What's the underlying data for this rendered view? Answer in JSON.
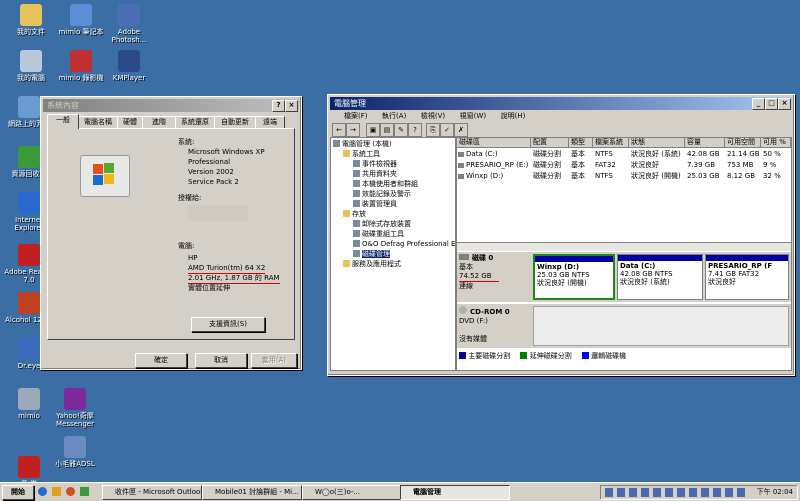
{
  "desktop_icons": [
    {
      "label": "我的文件",
      "icon": "folder-icon",
      "color": "#e8c25a"
    },
    {
      "label": "mimio 筆記本",
      "icon": "notebook-icon",
      "color": "#5b8ed6"
    },
    {
      "label": "Adobe Photosh...",
      "icon": "photoshop-icon",
      "color": "#4a6fb5"
    },
    {
      "label": "我的電腦",
      "icon": "computer-icon",
      "color": "#b8c8d8"
    },
    {
      "label": "mimio 錄影機",
      "icon": "recorder-icon",
      "color": "#c03030"
    },
    {
      "label": "KMPlayer",
      "icon": "kmplayer-icon",
      "color": "#2a4a8a"
    },
    {
      "label": "網路上的芳鄰",
      "icon": "network-icon",
      "color": "#6a9ad0"
    },
    {
      "label": "資源回收筒",
      "icon": "recycle-bin-icon",
      "color": "#3a9a3a"
    },
    {
      "label": "Internet Explorer",
      "icon": "ie-icon",
      "color": "#2a6ad0"
    },
    {
      "label": "Adobe Reader 7.0",
      "icon": "acrobat-icon",
      "color": "#c02020"
    },
    {
      "label": "Alcohol 120%",
      "icon": "alcohol-icon",
      "color": "#c04020"
    },
    {
      "label": "Dr.eye",
      "icon": "dreye-icon",
      "color": "#3a6aba"
    },
    {
      "label": "mimio",
      "icon": "mimio-icon",
      "color": "#9aaabb"
    },
    {
      "label": "Yahoo!奇摩 Messenger",
      "icon": "yahoo-messenger-icon",
      "color": "#7a2a9a"
    },
    {
      "label": "小毛雅ADSL",
      "icon": "adsl-icon",
      "color": "#6a8ac0"
    },
    {
      "label": "易 学",
      "icon": "input-method-icon",
      "color": "#c02020"
    }
  ],
  "sysprop": {
    "title": "系統內容",
    "tabs": [
      "一般",
      "電腦名稱",
      "硬體",
      "進階",
      "系統還原",
      "自動更新",
      "遠端"
    ],
    "system_heading": "系統:",
    "system_lines": [
      "Microsoft Windows XP",
      "Professional",
      "Version 2002",
      "Service Pack 2"
    ],
    "registered_heading": "授權給:",
    "computer_heading": "電腦:",
    "computer_lines": [
      "HP",
      "AMD Turion(tm) 64 X2",
      "2.01 GHz, 1.87 GB 的 RAM",
      "實體位置延伸"
    ],
    "support_button": "支援資訊(S)",
    "ok": "確定",
    "cancel": "取消",
    "apply": "套用(A)"
  },
  "compmgmt": {
    "title": "電腦管理",
    "menu": [
      "檔案(F)",
      "執行(A)",
      "檢視(V)",
      "視窗(W)",
      "說明(H)"
    ],
    "tree": [
      {
        "label": "電腦管理 (本機)",
        "level": 0
      },
      {
        "label": "系統工具",
        "level": 1
      },
      {
        "label": "事件檢視器",
        "level": 2
      },
      {
        "label": "共用資料夾",
        "level": 2
      },
      {
        "label": "本機使用者和群組",
        "level": 2
      },
      {
        "label": "效能記錄及警示",
        "level": 2
      },
      {
        "label": "裝置管理員",
        "level": 2
      },
      {
        "label": "存放",
        "level": 1
      },
      {
        "label": "卸除式存放裝置",
        "level": 2
      },
      {
        "label": "磁碟重組工具",
        "level": 2
      },
      {
        "label": "O&O Defrag Professional Edi",
        "level": 2
      },
      {
        "label": "磁碟管理",
        "level": 2,
        "selected": true
      },
      {
        "label": "服務及應用程式",
        "level": 1
      }
    ],
    "columns": [
      "磁碟區",
      "配置",
      "類型",
      "檔案系統",
      "狀態",
      "容量",
      "可用空間",
      "可用 %"
    ],
    "volumes": [
      [
        "Data (C:)",
        "磁碟分割",
        "基本",
        "NTFS",
        "狀況良好 (系統)",
        "42.08 GB",
        "21.14 GB",
        "50 %"
      ],
      [
        "PRESARIO_RP (E:)",
        "磁碟分割",
        "基本",
        "FAT32",
        "狀況良好",
        "7.39 GB",
        "753 MB",
        "9 %"
      ],
      [
        "Winxp (D:)",
        "磁碟分割",
        "基本",
        "NTFS",
        "狀況良好 (開機)",
        "25.03 GB",
        "8.12 GB",
        "32 %"
      ]
    ],
    "disk0": {
      "name": "磁碟 0",
      "type": "基本",
      "size": "74.52 GB",
      "status": "連線"
    },
    "parts": [
      {
        "name": "Winxp  (D:)",
        "size": "25.03 GB NTFS",
        "status": "狀況良好 (開機)"
      },
      {
        "name": "Data  (C:)",
        "size": "42.08 GB NTFS",
        "status": "狀況良好 (系統)"
      },
      {
        "name": "PRESARIO_RP  (F",
        "size": "7.41 GB FAT32",
        "status": "狀況良好"
      }
    ],
    "cdrom": {
      "name": "CD-ROM 0",
      "type": "DVD (F:)",
      "status": "沒有媒體"
    },
    "legend": [
      "主要磁碟分割",
      "延伸磁碟分割",
      "邏輯磁碟機"
    ],
    "legend_colors": [
      "#0000a0",
      "#008000",
      "#0000ff"
    ]
  },
  "taskbar": {
    "start": "開始",
    "items": [
      "收件匣 - Microsoft Outlook",
      "Mobile01 討論群組 - Mi...",
      "W◯o(三)o-...",
      "電腦管理"
    ],
    "clock": "下午 02:04"
  }
}
